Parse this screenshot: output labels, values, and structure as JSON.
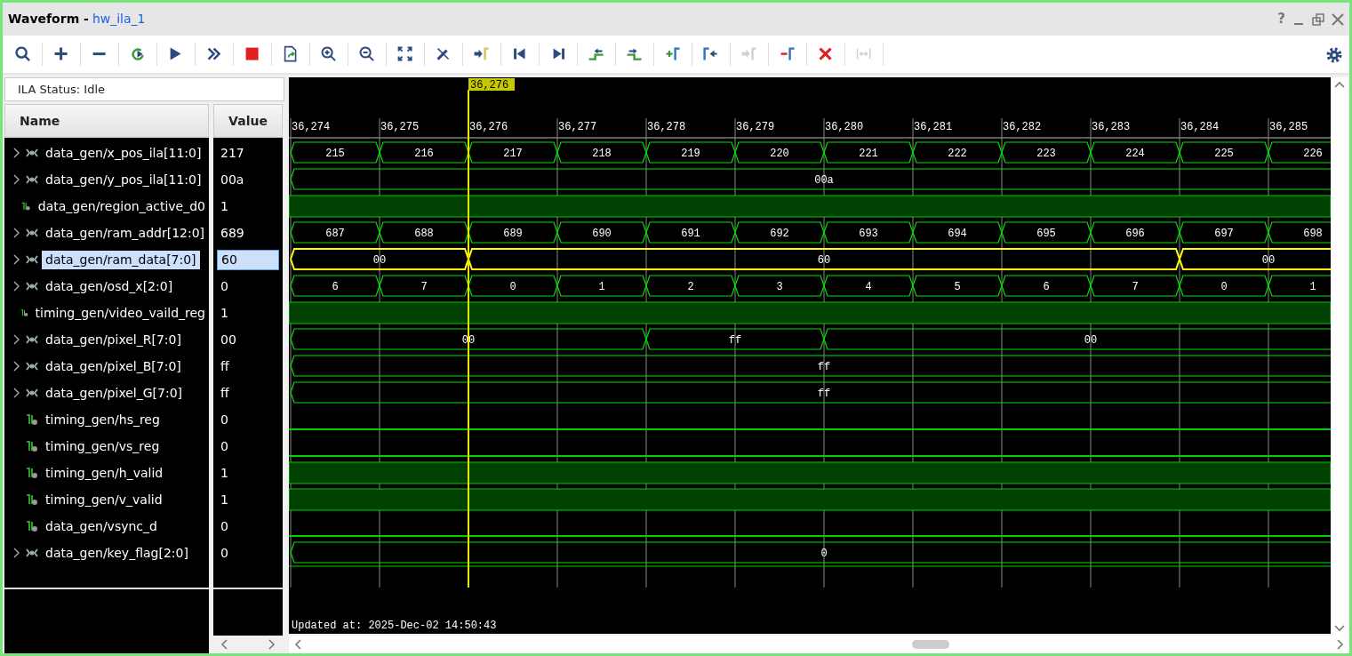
{
  "window": {
    "title": "Waveform -",
    "subtitle": "hw_ila_1",
    "help": "?"
  },
  "toolbar": [
    {
      "disabled": false
    },
    {
      "disabled": false
    },
    {
      "disabled": false
    },
    {
      "disabled": false
    },
    {
      "disabled": false
    },
    {
      "disabled": false
    },
    {
      "disabled": false
    },
    {
      "disabled": false
    },
    {
      "disabled": false
    },
    {
      "disabled": false
    },
    {
      "disabled": false
    },
    {
      "disabled": false
    },
    {
      "disabled": false
    },
    {
      "disabled": false
    },
    {
      "disabled": false
    },
    {
      "disabled": false
    },
    {
      "disabled": false
    },
    {
      "disabled": false
    },
    {
      "disabled": false
    },
    {
      "disabled": true
    },
    {
      "disabled": false
    },
    {
      "disabled": false
    },
    {
      "disabled": true
    }
  ],
  "status": "ILA Status:  Idle",
  "columns": [
    "Name",
    "Value"
  ],
  "timeline": {
    "cursor_label": "36,276",
    "updated": "Updated at: 2025-Dec-02 14:50:43",
    "ticks": [
      {
        "label": "36,274",
        "cursor": false
      },
      {
        "label": "36,275",
        "cursor": false
      },
      {
        "label": "36,276",
        "cursor": true
      },
      {
        "label": "36,277",
        "cursor": false
      },
      {
        "label": "36,278",
        "cursor": false
      },
      {
        "label": "36,279",
        "cursor": false
      },
      {
        "label": "36,280",
        "cursor": false
      },
      {
        "label": "36,281",
        "cursor": false
      },
      {
        "label": "36,282",
        "cursor": false
      },
      {
        "label": "36,283",
        "cursor": false
      },
      {
        "label": "36,284",
        "cursor": false
      },
      {
        "label": "36,285",
        "cursor": false
      }
    ]
  },
  "signals": [
    {
      "name": "data_gen/x_pos_ila[11:0]",
      "value": "217",
      "kind": "bus",
      "selected": false,
      "cycles": [
        {
          "change": true,
          "label": "215"
        },
        {
          "change": true,
          "label": "216"
        },
        {
          "change": true,
          "label": "217"
        },
        {
          "change": true,
          "label": "218"
        },
        {
          "change": true,
          "label": "219"
        },
        {
          "change": true,
          "label": "220"
        },
        {
          "change": true,
          "label": "221"
        },
        {
          "change": true,
          "label": "222"
        },
        {
          "change": true,
          "label": "223"
        },
        {
          "change": true,
          "label": "224"
        },
        {
          "change": true,
          "label": "225"
        },
        {
          "change": true,
          "label": "226"
        }
      ]
    },
    {
      "name": "data_gen/y_pos_ila[11:0]",
      "value": "00a",
      "kind": "bus",
      "selected": false,
      "cycles": [
        {
          "change": true,
          "label": "00a"
        },
        {
          "change": false
        },
        {
          "change": false
        },
        {
          "change": false
        },
        {
          "change": false
        },
        {
          "change": false
        },
        {
          "change": false
        },
        {
          "change": false
        },
        {
          "change": false
        },
        {
          "change": false
        },
        {
          "change": false
        },
        {
          "change": false
        }
      ]
    },
    {
      "name": "data_gen/region_active_d0",
      "value": "1",
      "kind": "bit",
      "selected": false,
      "high": true
    },
    {
      "name": "data_gen/ram_addr[12:0]",
      "value": "689",
      "kind": "bus",
      "selected": false,
      "cycles": [
        {
          "change": true,
          "label": "687"
        },
        {
          "change": true,
          "label": "688"
        },
        {
          "change": true,
          "label": "689"
        },
        {
          "change": true,
          "label": "690"
        },
        {
          "change": true,
          "label": "691"
        },
        {
          "change": true,
          "label": "692"
        },
        {
          "change": true,
          "label": "693"
        },
        {
          "change": true,
          "label": "694"
        },
        {
          "change": true,
          "label": "695"
        },
        {
          "change": true,
          "label": "696"
        },
        {
          "change": true,
          "label": "697"
        },
        {
          "change": true,
          "label": "698"
        }
      ]
    },
    {
      "name": "data_gen/ram_data[7:0]",
      "value": "60",
      "kind": "bus",
      "selected": true,
      "cycles": [
        {
          "change": true,
          "label": "00"
        },
        {
          "change": false
        },
        {
          "change": true,
          "label": "60"
        },
        {
          "change": false
        },
        {
          "change": false
        },
        {
          "change": false
        },
        {
          "change": false
        },
        {
          "change": false
        },
        {
          "change": false
        },
        {
          "change": false
        },
        {
          "change": true,
          "label": "00"
        },
        {
          "change": false
        }
      ]
    },
    {
      "name": "data_gen/osd_x[2:0]",
      "value": "0",
      "kind": "bus",
      "selected": false,
      "cycles": [
        {
          "change": true,
          "label": "6"
        },
        {
          "change": true,
          "label": "7"
        },
        {
          "change": true,
          "label": "0"
        },
        {
          "change": true,
          "label": "1"
        },
        {
          "change": true,
          "label": "2"
        },
        {
          "change": true,
          "label": "3"
        },
        {
          "change": true,
          "label": "4"
        },
        {
          "change": true,
          "label": "5"
        },
        {
          "change": true,
          "label": "6"
        },
        {
          "change": true,
          "label": "7"
        },
        {
          "change": true,
          "label": "0"
        },
        {
          "change": true,
          "label": "1"
        }
      ]
    },
    {
      "name": "timing_gen/video_vaild_reg",
      "value": "1",
      "kind": "bit",
      "selected": false,
      "high": true
    },
    {
      "name": "data_gen/pixel_R[7:0]",
      "value": "00",
      "kind": "bus",
      "selected": false,
      "cycles": [
        {
          "change": true,
          "label": "00"
        },
        {
          "change": false
        },
        {
          "change": false
        },
        {
          "change": false
        },
        {
          "change": true,
          "label": "ff"
        },
        {
          "change": false
        },
        {
          "change": true,
          "label": "00"
        },
        {
          "change": false
        },
        {
          "change": false
        },
        {
          "change": false
        },
        {
          "change": false
        },
        {
          "change": false
        }
      ]
    },
    {
      "name": "data_gen/pixel_B[7:0]",
      "value": "ff",
      "kind": "bus",
      "selected": false,
      "cycles": [
        {
          "change": true,
          "label": "ff"
        },
        {
          "change": false
        },
        {
          "change": false
        },
        {
          "change": false
        },
        {
          "change": false
        },
        {
          "change": false
        },
        {
          "change": false
        },
        {
          "change": false
        },
        {
          "change": false
        },
        {
          "change": false
        },
        {
          "change": false
        },
        {
          "change": false
        }
      ]
    },
    {
      "name": "data_gen/pixel_G[7:0]",
      "value": "ff",
      "kind": "bus",
      "selected": false,
      "cycles": [
        {
          "change": true,
          "label": "ff"
        },
        {
          "change": false
        },
        {
          "change": false
        },
        {
          "change": false
        },
        {
          "change": false
        },
        {
          "change": false
        },
        {
          "change": false
        },
        {
          "change": false
        },
        {
          "change": false
        },
        {
          "change": false
        },
        {
          "change": false
        },
        {
          "change": false
        }
      ]
    },
    {
      "name": "timing_gen/hs_reg",
      "value": "0",
      "kind": "bit",
      "selected": false,
      "high": false
    },
    {
      "name": "timing_gen/vs_reg",
      "value": "0",
      "kind": "bit",
      "selected": false,
      "high": false
    },
    {
      "name": "timing_gen/h_valid",
      "value": "1",
      "kind": "bit",
      "selected": false,
      "high": true
    },
    {
      "name": "timing_gen/v_valid",
      "value": "1",
      "kind": "bit",
      "selected": false,
      "high": true
    },
    {
      "name": "data_gen/vsync_d",
      "value": "0",
      "kind": "bit",
      "selected": false,
      "high": false
    },
    {
      "name": "data_gen/key_flag[2:0]",
      "value": "0",
      "kind": "bus",
      "selected": false,
      "cycles": [
        {
          "change": true,
          "label": "0"
        },
        {
          "change": false
        },
        {
          "change": false
        },
        {
          "change": false
        },
        {
          "change": false
        },
        {
          "change": false
        },
        {
          "change": false
        },
        {
          "change": false
        },
        {
          "change": false
        },
        {
          "change": false
        },
        {
          "change": false
        },
        {
          "change": false
        }
      ]
    }
  ]
}
